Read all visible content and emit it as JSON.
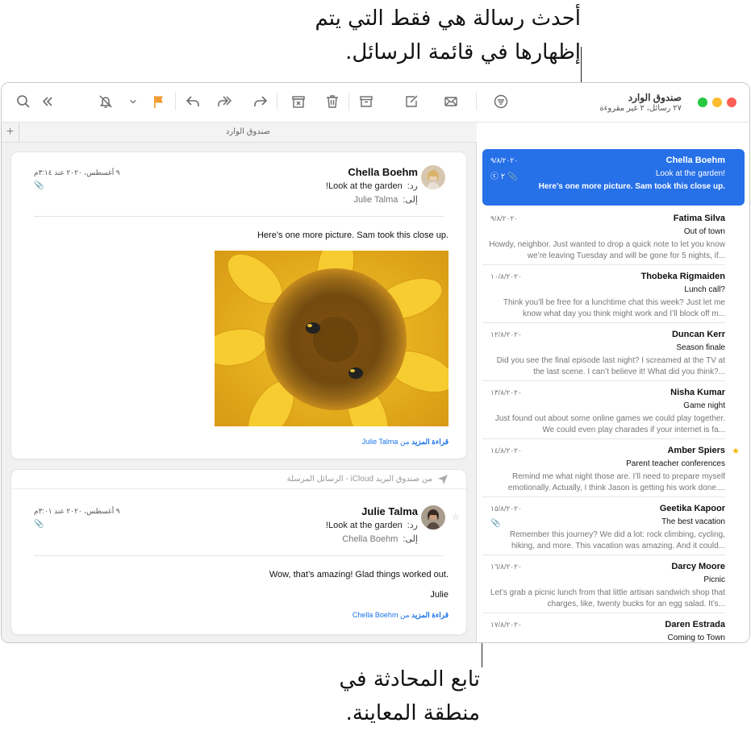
{
  "callouts": {
    "top": "أحدث رسالة هي فقط التي يتم إظهارها في قائمة الرسائل.",
    "bottom": "تابع المحادثة في منطقة المعاينة."
  },
  "colors": {
    "accent": "#2670e8",
    "flag": "#f29a2e",
    "star": "#f5b800",
    "close": "#fe5f57",
    "minimize": "#febc2e",
    "zoom": "#28c840"
  },
  "toolbar": {
    "mailbox_title": "صندوق الوارد",
    "mailbox_subtitle": "٢٧ رسائل، ٢ غير مقروءة",
    "icons": [
      "search-icon",
      "chevron-double-left-icon",
      "bell-slash-icon",
      "chevron-down-icon",
      "flag-icon",
      "reply-icon",
      "reply-all-icon",
      "forward-icon",
      "archive-junk-icon",
      "trash-icon",
      "archive-icon",
      "compose-icon",
      "envelope-icon",
      "filter-icon"
    ]
  },
  "tabbar": {
    "add": "+",
    "title": "صندوق الوارد"
  },
  "preview": {
    "card1": {
      "sender": "Chella Boehm",
      "re_label": "رد:",
      "subject": "Look at the garden!",
      "to_label": "إلى:",
      "to": "Julie Talma",
      "date": "٩ أغسطس، ٢٠٢٠ عند ٣:١٤م",
      "body": "Here’s one more picture. Sam took this close up.",
      "more_label": "قراءة المزيد",
      "more_from": "من Julie Talma"
    },
    "card2": {
      "folder": "من صندوق البريد iCloud - الرسائل المرسلة",
      "sender": "Julie Talma",
      "re_label": "رد:",
      "subject": "Look at the garden!",
      "to_label": "إلى:",
      "to": "Chella Boehm",
      "date": "٩ أغسطس، ٢٠٢٠ عند ٣:٠١م",
      "body": "Wow, that’s amazing! Glad things worked out.",
      "signature": "Julie",
      "more_label": "قراءة المزيد",
      "more_from": "من Chella Boehm"
    }
  },
  "messages": [
    {
      "sender": "Chella Boehm",
      "date": "٩/٨/٢٠٢٠",
      "subject": "Look at the garden!",
      "preview": "Here’s one more picture. Sam took this close up.",
      "count": "٢",
      "selected": true
    },
    {
      "sender": "Fatima Silva",
      "date": "٩/٨/٢٠٢٠",
      "subject": "Out of town",
      "preview": "Howdy, neighbor. Just wanted to drop a quick note to let you know we’re leaving Tuesday and will be gone for 5 nights, if..."
    },
    {
      "sender": "Thobeka Rigmaiden",
      "date": "١٠/٨/٢٠٢٠",
      "subject": "Lunch call?",
      "preview": "Think you’ll be free for a lunchtime chat this week? Just let me know what day you think might work and I’ll block off m..."
    },
    {
      "sender": "Duncan Kerr",
      "date": "١٢/٨/٢٠٢٠",
      "subject": "Season finale",
      "preview": "Did you see the final episode last night? I screamed at the TV at the last scene. I can’t believe it! What did you think?..."
    },
    {
      "sender": "Nisha Kumar",
      "date": "١٣/٨/٢٠٢٠",
      "subject": "Game night",
      "preview": "Just found out about some online games we could play together. We could even play charades if your internet is fa..."
    },
    {
      "sender": "Amber Spiers",
      "date": "١٤/٨/٢٠٢٠",
      "subject": "Parent teacher conferences",
      "preview": "Remind me what night those are. I’ll need to prepare myself emotionally. Actually, I think Jason is getting his work done....",
      "starred": true
    },
    {
      "sender": "Geetika Kapoor",
      "date": "١٥/٨/٢٠٢٠",
      "subject": "The best vacation",
      "preview": "Remember this journey? We did a lot: rock climbing, cycling, hiking, and more. This vacation was amazing. And it could...",
      "attachment": true
    },
    {
      "sender": "Darcy Moore",
      "date": "١٦/٨/٢٠٢٠",
      "subject": "Picnic",
      "preview": "Let’s grab a picnic lunch from that little artisan sandwich shop that charges, like, twenty bucks for an egg salad. It’s..."
    },
    {
      "sender": "Daren Estrada",
      "date": "١٧/٨/٢٠٢٠",
      "subject": "Coming to Town",
      "preview": ""
    }
  ]
}
